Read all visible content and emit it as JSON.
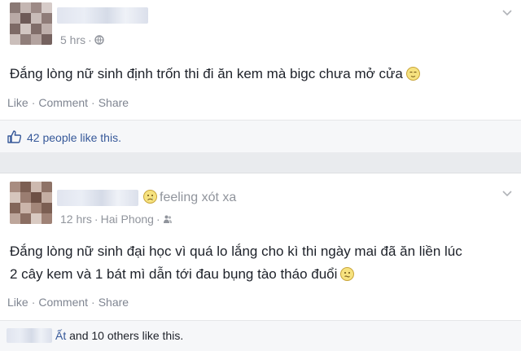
{
  "post1": {
    "time": "5 hrs",
    "text": "Đắng lòng nữ sinh định trốn thi đi ăn kem mà bigc chưa mở cửa",
    "actions": {
      "like": "Like",
      "comment": "Comment",
      "share": "Share"
    },
    "likes": "42 people like this."
  },
  "post2": {
    "feeling": "feeling xót xa",
    "time": "12 hrs",
    "location": "Hai Phong",
    "text_line1": "Đắng lòng nữ sinh đại học vì quá lo lắng cho kì thi ngày mai đã ăn liền lúc",
    "text_line2": "2 cây kem và 1 bát mì dẫn tới đau bụng tào tháo đuổi",
    "actions": {
      "like": "Like",
      "comment": "Comment",
      "share": "Share"
    },
    "likes_prefix": "Ất",
    "likes_rest": " and 10 others like this."
  },
  "colors": {
    "link": "#365899",
    "meta": "#90949c",
    "text": "#1d2129"
  }
}
